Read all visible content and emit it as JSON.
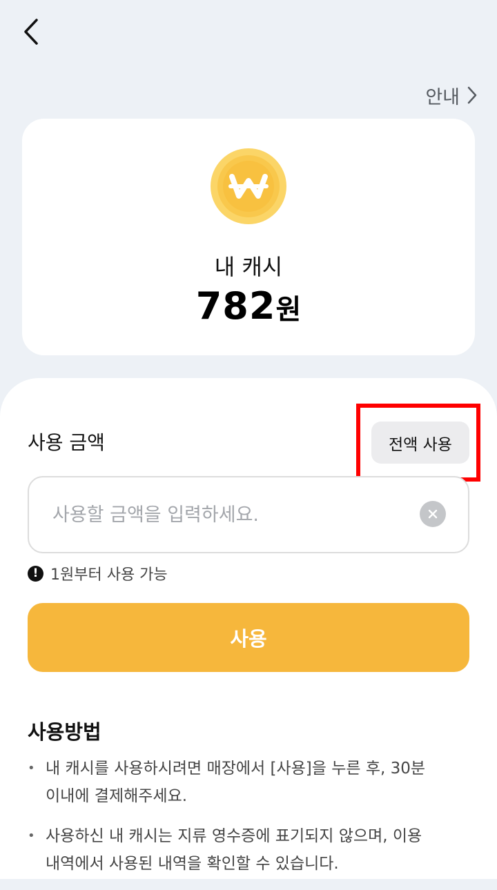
{
  "header": {
    "back_icon": "chevron-left-icon",
    "guide_label": "안내",
    "guide_icon": "chevron-right-icon"
  },
  "balance": {
    "coin_icon": "won-coin-icon",
    "label": "내 캐시",
    "amount": "782",
    "unit": "원"
  },
  "use_form": {
    "amount_label": "사용 금액",
    "full_use_label": "전액 사용",
    "input_value": "",
    "input_placeholder": "사용할 금액을 입력하세요.",
    "clear_icon": "clear-circle-icon",
    "notice_icon": "exclamation-circle-icon",
    "notice_text": "1원부터 사용 가능",
    "submit_label": "사용"
  },
  "howto": {
    "title": "사용방법",
    "items": [
      {
        "bullet": "•",
        "text": "내 캐시를 사용하시려면 매장에서 [사용]을 누른 후, 30분 이내에 결제해주세요."
      },
      {
        "bullet": "•",
        "text": "사용하신 내 캐시는 지류 영수증에 표기되지 않으며, 이용내역에서 사용된 내역을 확인할 수 있습니다."
      }
    ]
  },
  "colors": {
    "page_background": "#edf1f6",
    "accent": "#f6b73c",
    "coin_outer": "#fbd567",
    "coin_inner": "#f8c140",
    "highlight": "#ff0000"
  }
}
